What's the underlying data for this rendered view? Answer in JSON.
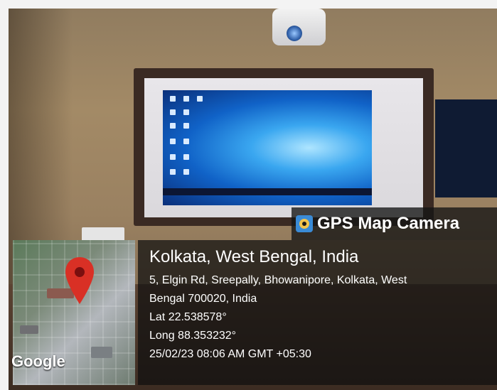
{
  "overlay": {
    "app_title": "GPS Map Camera",
    "app_icon": "gps-map-camera-icon"
  },
  "location": {
    "place": "Kolkata, West Bengal, India",
    "address_line1": "5, Elgin Rd, Sreepally, Bhowanipore, Kolkata, West",
    "address_line2": "Bengal 700020, India",
    "lat": "Lat 22.538578°",
    "long": "Long 88.353232°",
    "datetime": "25/02/23 08:06 AM GMT +05:30"
  },
  "map": {
    "brand": "Google",
    "pin_icon": "map-pin-icon",
    "pin_color": "#d93025"
  }
}
